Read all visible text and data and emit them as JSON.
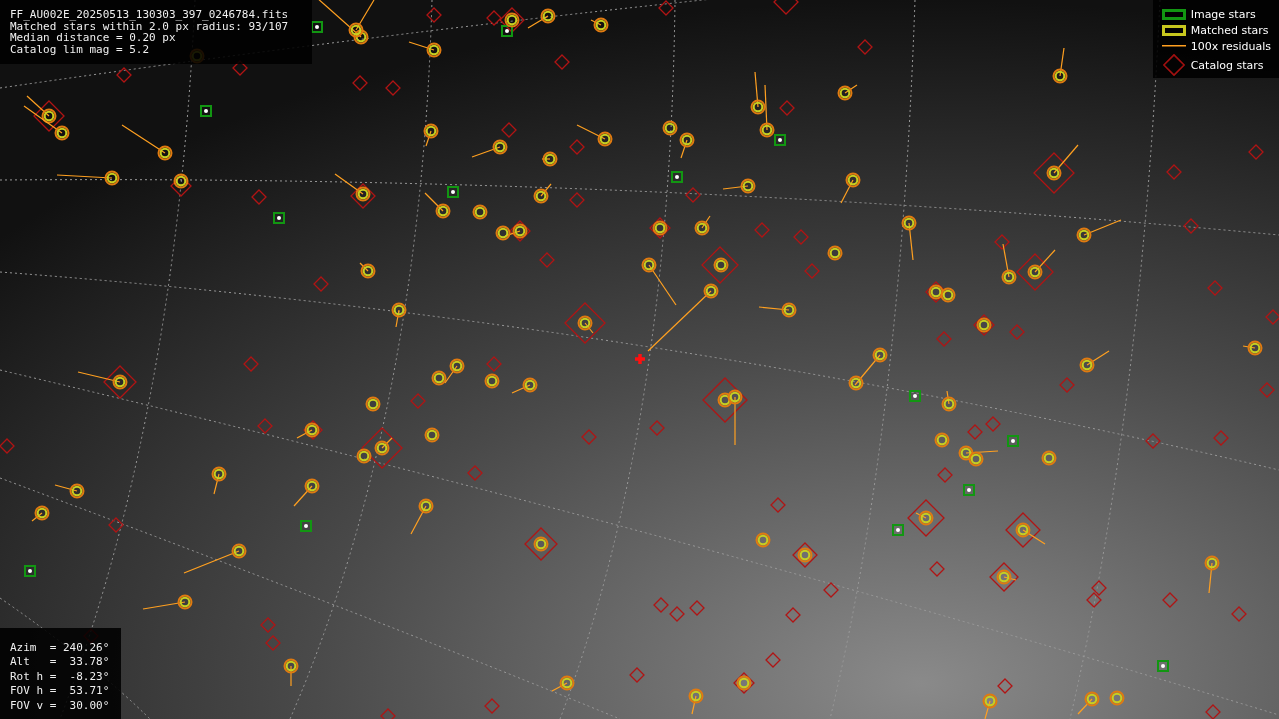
{
  "info": {
    "lines": [
      "FF_AU002E_20250513_130303_397_0246784.fits",
      "Matched stars within 2.0 px radius: 93/107",
      "Median distance = 0.20 px",
      "Catalog lim mag = 5.2"
    ]
  },
  "legend": [
    {
      "kind": "image",
      "label": "Image stars"
    },
    {
      "kind": "matched",
      "label": "Matched stars"
    },
    {
      "kind": "residual",
      "label": "100x residuals"
    },
    {
      "kind": "catalog",
      "label": "Catalog stars"
    }
  ],
  "pointing": {
    "lines": [
      "Azim  = 240.26°",
      "Alt   =  33.78°",
      "Rot h =  -8.23°",
      "FOV h =  53.71°",
      "FOV v =  30.00°"
    ]
  }
}
